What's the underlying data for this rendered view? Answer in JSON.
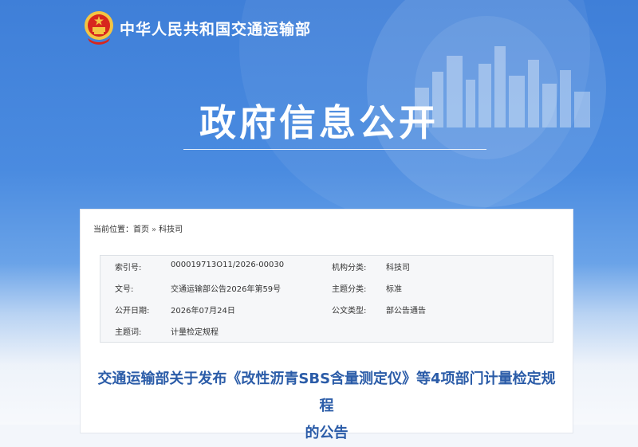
{
  "header": {
    "ministry_name": "中华人民共和国交通运输部",
    "portal_title": "政府信息公开"
  },
  "breadcrumb": {
    "prefix": "当前位置：",
    "items": [
      "首页",
      "科技司"
    ],
    "separator": "»"
  },
  "metadata": {
    "rows": [
      {
        "label": "索引号:",
        "value": "000019713O11/2026-00030",
        "label2": "机构分类:",
        "value2": "科技司"
      },
      {
        "label": "文号:",
        "value": "交通运输部公告2026年第59号",
        "label2": "主题分类:",
        "value2": "标准"
      },
      {
        "label": "公开日期:",
        "value": "2026年07月24日",
        "label2": "公文类型:",
        "value2": "部公告通告"
      },
      {
        "label": "主题词:",
        "value": "计量检定规程",
        "label2": "",
        "value2": ""
      }
    ]
  },
  "document": {
    "title_line1": "交通运输部关于发布《改性沥青SBS含量测定仪》等4项部门计量检定规程",
    "title_line2": "的公告"
  },
  "colors": {
    "banner_blue": "#3f7fd8",
    "title_blue": "#2b5ca8",
    "emblem_red": "#d7261e",
    "emblem_gold": "#f4c542"
  }
}
